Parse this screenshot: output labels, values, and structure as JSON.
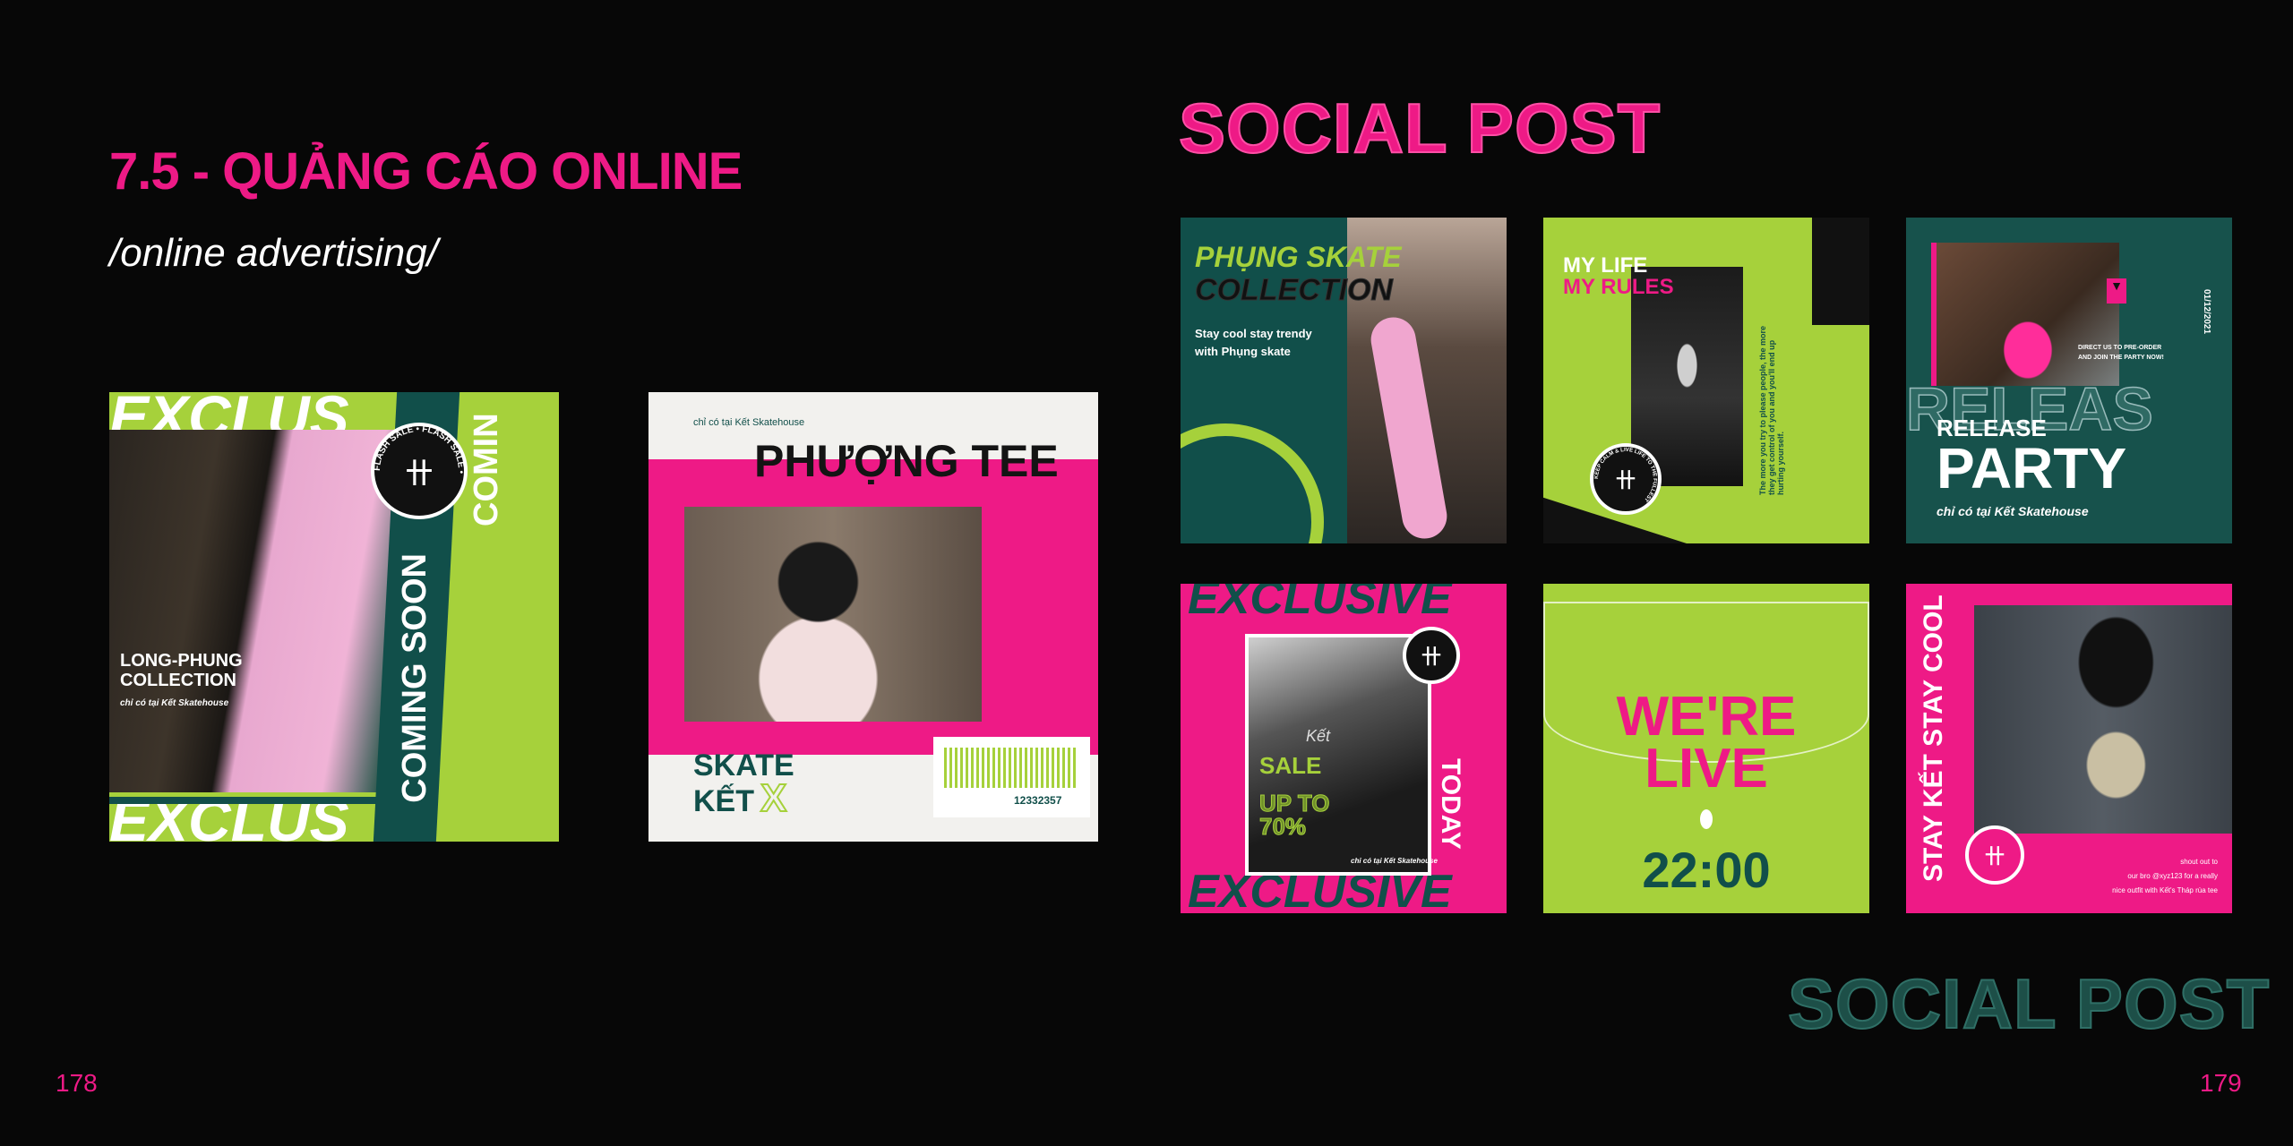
{
  "page": {
    "title": "7.5 - QUẢNG CÁO ONLINE",
    "subtitle": "/online advertising/",
    "social_heading": "SOCIAL POST",
    "social_footer": "SOCIAL POST",
    "page_left": "178",
    "page_right": "179"
  },
  "colors": {
    "pink": "#ee1a86",
    "lime": "#a6d13b",
    "teal": "#114f4a",
    "background": "#070707"
  },
  "cards": {
    "longphung": {
      "bg_word": "EXCLUS",
      "title1": "LONG-PHUNG",
      "title2": "COLLECTION",
      "tagline": "chỉ có tại Kết Skatehouse",
      "band": "COMING SOON",
      "band2": "COMIN",
      "badge": "FLASH SALE • FLASH SALE •"
    },
    "phuong": {
      "tagline": "chỉ có tại Kết Skatehouse",
      "title": "PHƯỢNG TEE",
      "skate": "SKATE",
      "ket": "KẾT",
      "x": "X",
      "barcode": "12332357"
    },
    "phung_skate": {
      "title1": "PHỤNG SKATE",
      "title2": "COLLECTION",
      "line1": "Stay cool stay trendy",
      "line2": "with Phụng skate"
    },
    "my_life": {
      "line1": "MY LIFE",
      "line2": "MY RULES",
      "quote": "The more you try to please people, the more they get control of you and you'll end up hurting yourself.",
      "badge": "KEEP CALM & LIVE LIFE TO THE FULLEST"
    },
    "release": {
      "bg_word": "RELEAS",
      "title1": "RELEASE",
      "title2": "PARTY",
      "tagline": "chỉ có tại Kết Skatehouse",
      "note": "DIRECT US TO PRE-ORDER AND JOIN THE PARTY NOW!",
      "date": "01/12/2021"
    },
    "exclusive": {
      "bg_word": "EXCLUSIVE",
      "sale": "SALE",
      "upto1": "UP TO",
      "upto2": "70%",
      "side": "TODAY",
      "tagline": "chỉ có tại Kết Skatehouse",
      "shirt": "Kết"
    },
    "live": {
      "line1": "WE'RE",
      "line2": "LIVE",
      "time": "22:00"
    },
    "stay_cool": {
      "side": "STAY KẾT STAY COOL",
      "line1": "shout out to",
      "line2": "our bro @xyz123 for a really",
      "line3": "nice outfit with Kết's Tháp rùa tee"
    }
  }
}
